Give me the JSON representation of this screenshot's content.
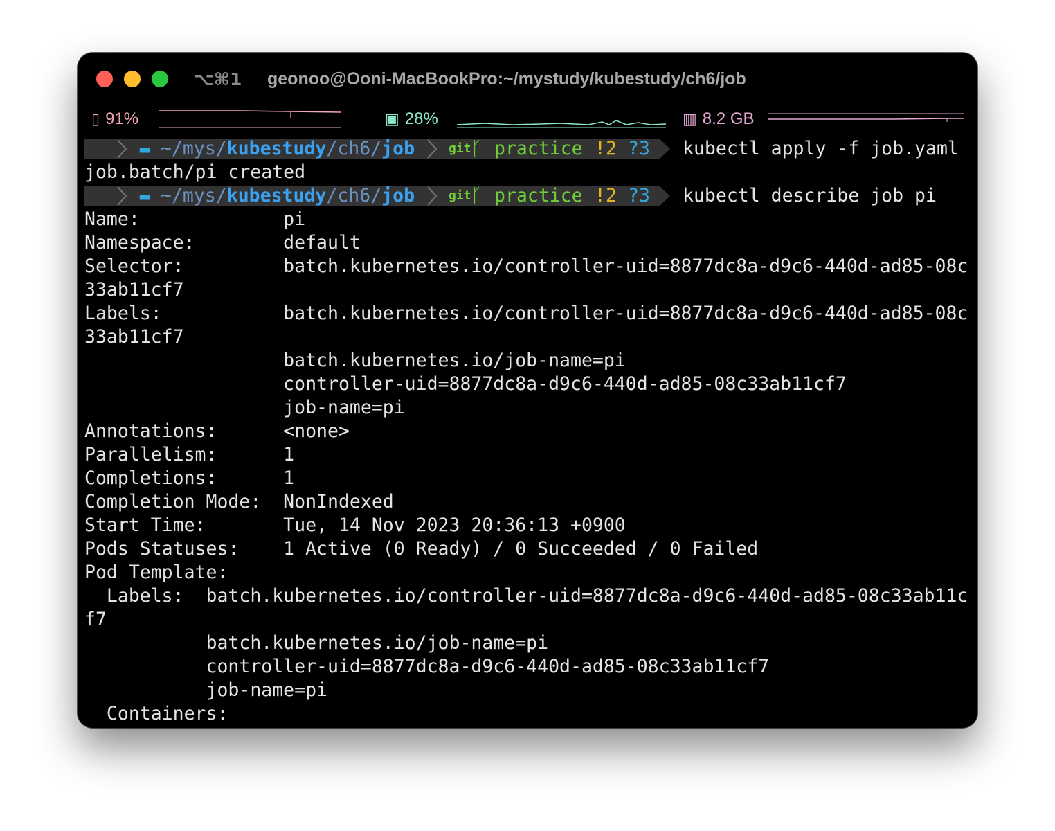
{
  "window": {
    "shortcut": "⌥⌘1",
    "title": "geonoo@Ooni-MacBookPro:~/mystudy/kubestudy/ch6/job"
  },
  "stats": {
    "battery": {
      "value": "91%",
      "color": "#f2a4b2"
    },
    "cpu": {
      "value": "28%",
      "color": "#8ee8c8"
    },
    "memory": {
      "value": "8.2 GB",
      "color": "#e8a8d4"
    }
  },
  "prompt": {
    "path_prefix": "~/",
    "path_mys": "mys",
    "sep1": "/",
    "path_kubestudy": "kubestudy",
    "sep2": "/",
    "path_ch6": "ch6",
    "sep3": "/",
    "path_job": "job",
    "git_label": "git",
    "branch": "practice",
    "modified": "!2",
    "untracked": "?3"
  },
  "commands": {
    "first": "kubectl apply -f job.yaml",
    "second": "kubectl describe job pi"
  },
  "output_apply": "job.batch/pi created",
  "output_lines": [
    "Name:             pi",
    "Namespace:        default",
    "Selector:         batch.kubernetes.io/controller-uid=8877dc8a-d9c6-440d-ad85-08c",
    "33ab11cf7",
    "Labels:           batch.kubernetes.io/controller-uid=8877dc8a-d9c6-440d-ad85-08c",
    "33ab11cf7",
    "                  batch.kubernetes.io/job-name=pi",
    "                  controller-uid=8877dc8a-d9c6-440d-ad85-08c33ab11cf7",
    "                  job-name=pi",
    "Annotations:      <none>",
    "Parallelism:      1",
    "Completions:      1",
    "Completion Mode:  NonIndexed",
    "Start Time:       Tue, 14 Nov 2023 20:36:13 +0900",
    "Pods Statuses:    1 Active (0 Ready) / 0 Succeeded / 0 Failed",
    "Pod Template:",
    "  Labels:  batch.kubernetes.io/controller-uid=8877dc8a-d9c6-440d-ad85-08c33ab11c",
    "f7",
    "           batch.kubernetes.io/job-name=pi",
    "           controller-uid=8877dc8a-d9c6-440d-ad85-08c33ab11cf7",
    "           job-name=pi",
    "  Containers:"
  ],
  "colors": {
    "prompt_bg": "#333333",
    "git_green": "#6fcf3a",
    "status_yellow": "#e6b422",
    "status_blue": "#34a8e0",
    "path_dim": "#6a94c4",
    "path_bold": "#3aa0f0"
  }
}
